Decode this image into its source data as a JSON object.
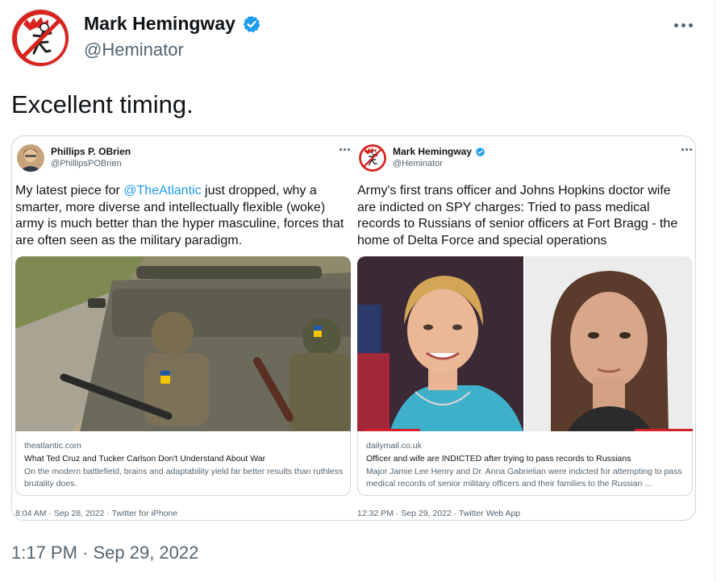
{
  "author": {
    "name": "Mark Hemingway",
    "handle": "@Heminator",
    "verified": true
  },
  "tweet": {
    "text": "Excellent timing.",
    "timestamp": "1:17 PM · Sep 29, 2022"
  },
  "quoted": [
    {
      "name": "Phillips P. OBrien",
      "handle": "@PhillipsPOBrien",
      "verified": false,
      "text_before_mention": "My latest piece for ",
      "mention": "@TheAtlantic",
      "text_after_mention": " just dropped, why a smarter, more diverse and intellectually flexible (woke) army is much better than the hyper masculine, forces that are often seen as the military paradigm.",
      "link_domain": "theatlantic.com",
      "link_title": "What Ted Cruz and Tucker Carlson Don't Understand About War",
      "link_description": "On the modern battlefield, brains and adaptability yield far better results than ruthless brutality does.",
      "time_source": "8:04 AM · Sep 28, 2022 · Twitter for iPhone"
    },
    {
      "name": "Mark Hemingway",
      "handle": "@Heminator",
      "verified": true,
      "text": "Army's first trans officer and Johns Hopkins doctor wife are indicted on SPY charges: Tried to pass medical records to Russians of senior officers at Fort Bragg - the home of Delta Force and special operations",
      "link_domain": "dailymail.co.uk",
      "link_title": "Officer and wife are INDICTED after trying to pass records to Russians",
      "link_description": "Major Jamie Lee Henry and Dr. Anna Gabrielian were indicted for attempting to pass medical records of senior military officers and their families to the Russian ...",
      "time_source": "12:32 PM · Sep 29, 2022 · Twitter Web App"
    }
  ],
  "colors": {
    "text": "#0f1419",
    "secondary": "#536471",
    "accent": "#1d9bf0",
    "border": "#cfd9de"
  },
  "icons": [
    "avatar-mascot-icon",
    "verified-badge-icon",
    "more-options-icon"
  ]
}
